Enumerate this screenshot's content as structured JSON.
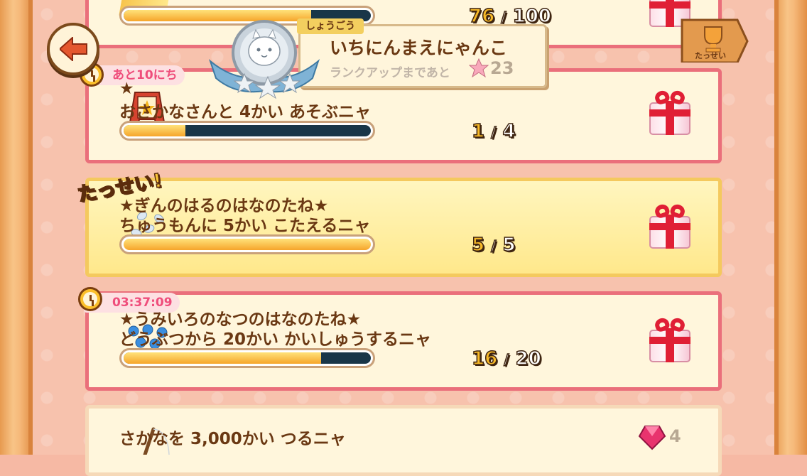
{
  "back_button": {
    "label": ""
  },
  "rank_popup": {
    "tag": "しょうごう",
    "title": "いちにんまえにゃんこ",
    "subtitle": "ランクアップまであと",
    "remaining": "23"
  },
  "trophy_button": {
    "label": "たっせい"
  },
  "quests": [
    {
      "title": "",
      "subtitle": "",
      "current": "76",
      "separator": "/",
      "goal": "100",
      "progress": 0.76
    },
    {
      "timer": "あと10にち",
      "title": "★",
      "subtitle": "おさかなさんと 4かい あそぶニャ",
      "current": "1",
      "separator": "/",
      "goal": "4",
      "progress": 0.25
    },
    {
      "badge": "たっせい!",
      "title": "★ぎんのはるのはなのたね★",
      "subtitle": "ちゅうもんに 5かい こたえるニャ",
      "current": "5",
      "separator": "/",
      "goal": "5",
      "progress": 1.0
    },
    {
      "timer": "03:37:09",
      "title": "★うみいろのなつのはなのたね★",
      "subtitle": "どうぶつから 20かい かいしゅうするニャ",
      "current": "16",
      "separator": "/",
      "goal": "20",
      "progress": 0.8
    },
    {
      "title": "さかなを 3,000かい つるニャ",
      "reward": "4"
    }
  ],
  "colors": {
    "accent": "#ea6f7b",
    "done": "#f4c95e",
    "text": "#6a3813",
    "timer_text": "#ef4d7b"
  }
}
